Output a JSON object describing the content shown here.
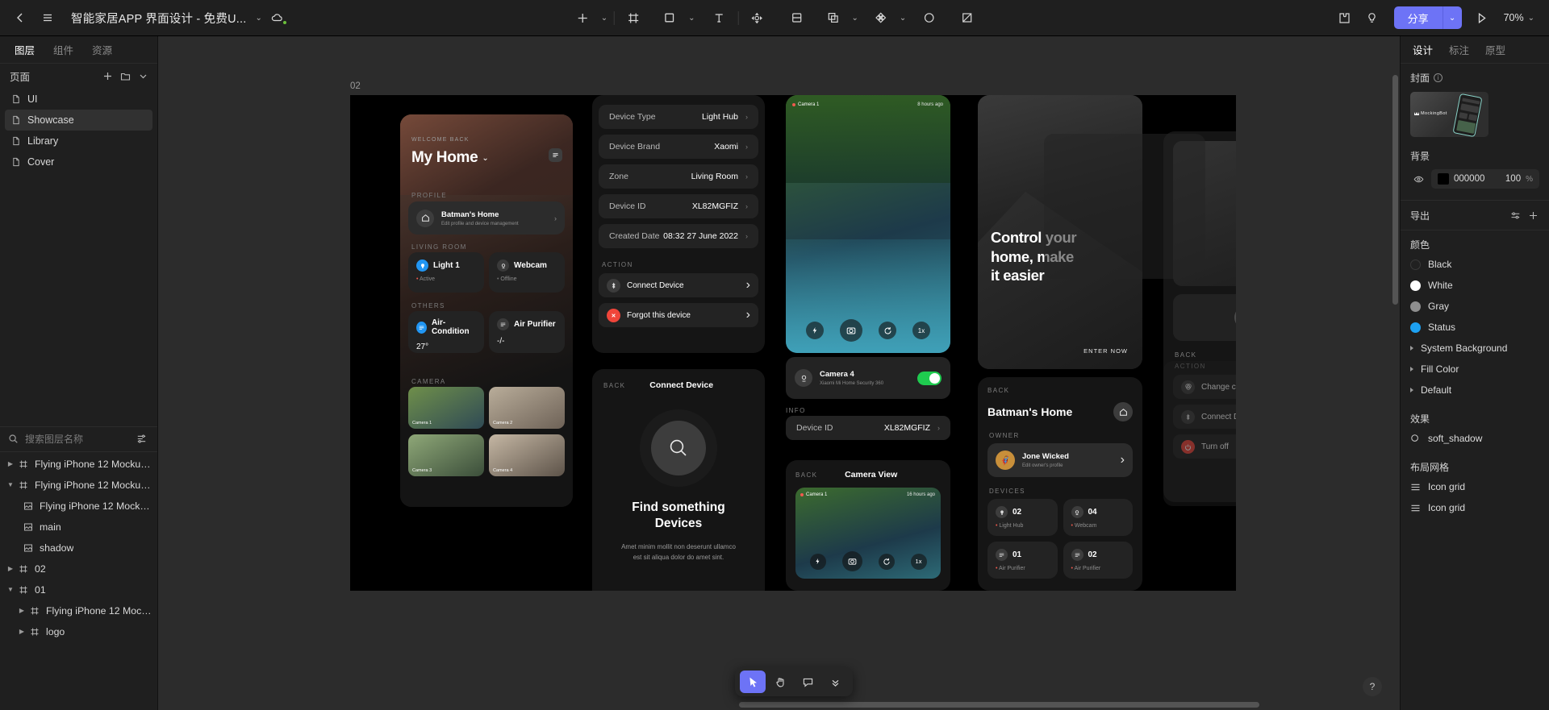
{
  "topbar": {
    "back_icon": "chevron-left-icon",
    "menu_icon": "hamburger-menu-icon",
    "document_title": "智能家居APP 界面设计 - 免费U...",
    "title_caret": "⌄",
    "cloud_icon": "cloud-sync-icon",
    "tools": [
      {
        "name": "insert-tool",
        "glyph": "+",
        "has_caret": true
      },
      {
        "name": "frame-tool",
        "glyph": "frame"
      },
      {
        "name": "shape-tool",
        "glyph": "square",
        "has_caret": true
      },
      {
        "name": "text-tool",
        "glyph": "T"
      },
      {
        "name": "transform-tool",
        "glyph": "move"
      },
      {
        "name": "mask-tool",
        "glyph": "mask"
      },
      {
        "name": "boolean-tool",
        "glyph": "boolean",
        "has_caret": true
      },
      {
        "name": "component-tool",
        "glyph": "component",
        "has_caret": true
      },
      {
        "name": "ellipse-tool",
        "glyph": "circle"
      },
      {
        "name": "slice-tool",
        "glyph": "slice"
      }
    ],
    "plugin_icon": "plugin-icon",
    "idea_icon": "lightbulb-icon",
    "share_label": "分享",
    "share_caret": "⌄",
    "present_icon": "play-icon",
    "zoom_level": "70%",
    "zoom_caret": "⌄"
  },
  "left_panel": {
    "tabs": [
      {
        "label": "图层",
        "active": true
      },
      {
        "label": "组件",
        "active": false
      },
      {
        "label": "资源",
        "active": false
      }
    ],
    "pages_title": "页面",
    "add_page_icon": "plus-icon",
    "add_folder_icon": "folder-icon",
    "collapse_icon": "chevron-down-icon",
    "pages": [
      {
        "label": "UI",
        "selected": false
      },
      {
        "label": "Showcase",
        "selected": true
      },
      {
        "label": "Library",
        "selected": false
      },
      {
        "label": "Cover",
        "selected": false
      }
    ],
    "search_placeholder": "搜索图层名称",
    "search_value": "",
    "search_icon": "search-icon",
    "filter_icon": "filter-icon",
    "layers": [
      {
        "label": "Flying iPhone 12 Mockup Left...",
        "icon": "frame-icon",
        "depth": 0,
        "expanded": false,
        "has_children": true
      },
      {
        "label": "Flying iPhone 12 Mockup Left...",
        "icon": "frame-icon",
        "depth": 0,
        "expanded": true,
        "has_children": true
      },
      {
        "label": "Flying iPhone 12 Mockup ...",
        "icon": "image-icon",
        "depth": 1,
        "has_children": false
      },
      {
        "label": "main",
        "icon": "image-icon",
        "depth": 1,
        "has_children": false
      },
      {
        "label": "shadow",
        "icon": "image-icon",
        "depth": 1,
        "has_children": false
      },
      {
        "label": "02",
        "icon": "frame-icon",
        "depth": 0,
        "expanded": false,
        "has_children": true
      },
      {
        "label": "01",
        "icon": "frame-icon",
        "depth": 0,
        "expanded": true,
        "has_children": true
      },
      {
        "label": "Flying iPhone 12 Mockup ...",
        "icon": "frame-icon",
        "depth": 1,
        "expanded": false,
        "has_children": true
      },
      {
        "label": "logo",
        "icon": "frame-icon",
        "depth": 1,
        "expanded": false,
        "has_children": true
      }
    ]
  },
  "canvas": {
    "frame_name": "02",
    "screens": {
      "home": {
        "welcome": "WELCOME BACK",
        "title": "My Home",
        "title_caret": "⌄",
        "menu_icon": "hamburger-icon",
        "profile_label": "PROFILE",
        "profile_name": "Batman's Home",
        "profile_sub": "Edit profile and device management",
        "profile_icon": "home-icon",
        "living_room_label": "LIVING ROOM",
        "living_room_devices": [
          {
            "name": "Light 1",
            "status": "Active",
            "icon": "bulb-icon",
            "color": "#2196f3"
          },
          {
            "name": "Webcam",
            "status": "Offline",
            "icon": "camera-icon",
            "color": "#3a3a3a"
          }
        ],
        "others_label": "OTHERS",
        "others_devices": [
          {
            "name": "Air-Condition",
            "value": "27°",
            "icon": "ac-icon",
            "color": "#2196f3"
          },
          {
            "name": "Air Purifier",
            "value": "-/-",
            "icon": "purifier-icon",
            "color": "#3a3a3a"
          }
        ],
        "camera_label": "CAMERA",
        "cameras": [
          "Camera 1",
          "Camera 2",
          "Camera 3",
          "Camera 4"
        ]
      },
      "device_detail": {
        "rows": [
          {
            "label": "Device Type",
            "value": "Light Hub"
          },
          {
            "label": "Device Brand",
            "value": "Xaomi"
          },
          {
            "label": "Zone",
            "value": "Living Room"
          },
          {
            "label": "Device ID",
            "value": "XL82MGFIZ"
          },
          {
            "label": "Created Date",
            "value": "08:32 27 June 2022"
          }
        ],
        "action_label": "ACTION",
        "actions": [
          {
            "label": "Connect Device",
            "icon": "bluetooth-icon",
            "danger": false
          },
          {
            "label": "Forgot this device",
            "icon": "forget-icon",
            "danger": true
          }
        ]
      },
      "connect": {
        "back_label": "BACK",
        "title": "Connect Device",
        "search_icon": "search-icon",
        "heading_line1": "Find something",
        "heading_line2": "Devices",
        "body": "Amet minim mollit non deserunt ullamco est sit aliqua dolor do amet sint."
      },
      "camera_live": {
        "camera_tag": "Camera 1",
        "timestamp": "8 hours ago",
        "controls": [
          "flash-icon",
          "capture-icon",
          "refresh-icon",
          "1x"
        ],
        "device_name": "Camera 4",
        "device_sub": "Xiaomi Mi Home Security 360",
        "toggle_on": true,
        "info_label": "INFO",
        "info_row": {
          "label": "Device ID",
          "value": "XL82MGFIZ"
        },
        "view_back": "BACK",
        "view_title": "Camera View",
        "view_tag": "Camera 1",
        "view_time": "16 hours ago"
      },
      "promo": {
        "headline_line1": "Control your",
        "headline_line2": "home, make",
        "headline_line3": "it easier",
        "cta": "ENTER NOW"
      },
      "owner": {
        "back_label": "BACK",
        "title": "Batman's Home",
        "home_icon": "home-icon",
        "owner_label": "OWNER",
        "owner_name": "Jone Wicked",
        "owner_sub": "Edit owner's profile",
        "devices_label": "DEVICES",
        "devices": [
          {
            "count": "02",
            "name": "Light Hub",
            "icon": "bulb-icon"
          },
          {
            "count": "04",
            "name": "Webcam",
            "icon": "camera-icon"
          },
          {
            "count": "01",
            "name": "Air Purifier",
            "icon": "purifier-icon"
          },
          {
            "count": "02",
            "name": "Air Purifier",
            "icon": "purifier-icon"
          }
        ]
      },
      "actions_panel": {
        "back_label": "BACK",
        "action_label": "ACTION",
        "items": [
          {
            "label": "Change color",
            "icon": "color-icon",
            "danger": false
          },
          {
            "label": "Connect Device",
            "icon": "bluetooth-icon",
            "danger": false
          },
          {
            "label": "Turn off",
            "icon": "power-icon",
            "danger": true
          }
        ]
      }
    },
    "dock": [
      {
        "name": "select-tool",
        "glyph": "cursor",
        "active": true
      },
      {
        "name": "hand-tool",
        "glyph": "hand",
        "active": false
      },
      {
        "name": "comment-tool",
        "glyph": "comment",
        "active": false
      },
      {
        "name": "more-tool",
        "glyph": "chevrons-down",
        "active": false
      }
    ],
    "help_label": "?"
  },
  "right_panel": {
    "tabs": [
      {
        "label": "设计",
        "active": true
      },
      {
        "label": "标注",
        "active": false
      },
      {
        "label": "原型",
        "active": false
      }
    ],
    "cover_title": "封面",
    "cover_info_icon": "info-icon",
    "cover_thumb_brand": "MockingBot",
    "background_title": "背景",
    "background_visibility_icon": "eye-icon",
    "background_color": "000000",
    "background_swatch": "#000000",
    "background_opacity": "100",
    "background_unit": "%",
    "export_title": "导出",
    "export_settings_icon": "sliders-icon",
    "export_add_icon": "plus-icon",
    "colors_title": "颜色",
    "color_styles": [
      {
        "label": "Black",
        "swatch": "#212121",
        "type": "dot"
      },
      {
        "label": "White",
        "swatch": "#ffffff",
        "type": "dot"
      },
      {
        "label": "Gray",
        "swatch": "#8e8e8e",
        "type": "dot"
      },
      {
        "label": "Status",
        "swatch": "#1da1f2",
        "type": "dot"
      },
      {
        "label": "System Background",
        "type": "group"
      },
      {
        "label": "Fill Color",
        "type": "group"
      },
      {
        "label": "Default",
        "type": "group"
      }
    ],
    "effects_title": "效果",
    "effects": [
      {
        "label": "soft_shadow",
        "icon": "effect-icon"
      }
    ],
    "grid_title": "布局网格",
    "grids": [
      {
        "label": "Icon grid",
        "icon": "grid-icon"
      },
      {
        "label": "Icon grid",
        "icon": "grid-icon"
      }
    ]
  }
}
